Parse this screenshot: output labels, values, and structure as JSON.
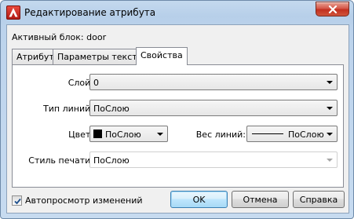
{
  "window": {
    "title": "Редактирование атрибута",
    "icon": "autocad-app-icon"
  },
  "active_block": "Активный блок: door",
  "tabs": [
    {
      "label": "Атрибут",
      "active": false
    },
    {
      "label": "Параметры текста",
      "active": false
    },
    {
      "label": "Свойства",
      "active": true
    }
  ],
  "properties": {
    "layer": {
      "label": "Слой:",
      "value": "0"
    },
    "linetype": {
      "label": "Тип линий:",
      "value": "ПоСлою"
    },
    "color": {
      "label": "Цвет:",
      "value": "ПоСлою",
      "swatch": "#000000"
    },
    "lineweight": {
      "label": "Вес линий:",
      "value": "ПоСлою"
    },
    "plotstyle": {
      "label": "Стиль печати:",
      "value": "ПоСлою",
      "disabled": true
    }
  },
  "autopreview": {
    "label": "Автопросмотр изменений",
    "checked": true
  },
  "buttons": {
    "ok": "OK",
    "cancel": "Отмена",
    "help": "Справка"
  }
}
